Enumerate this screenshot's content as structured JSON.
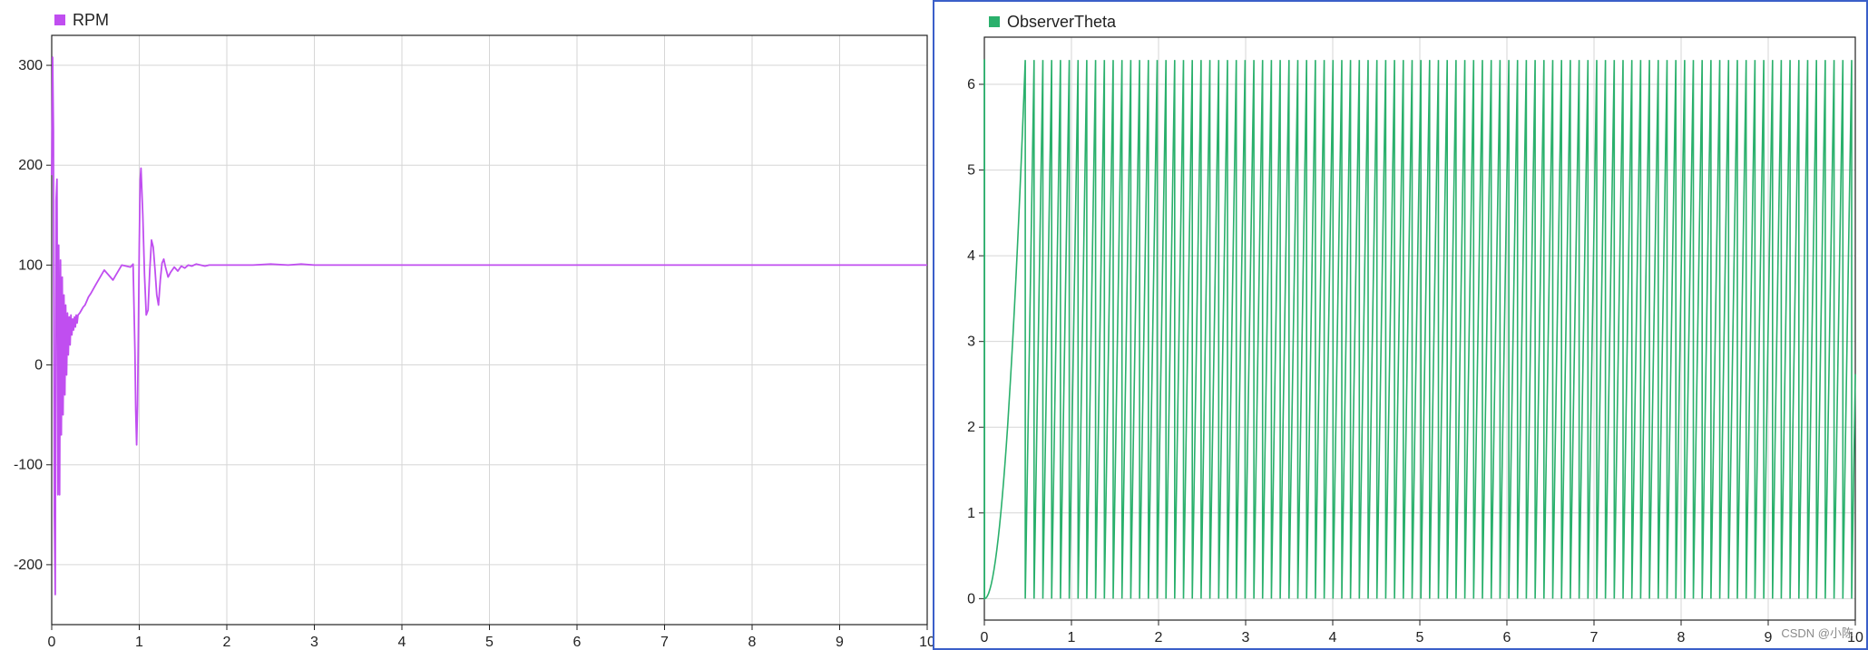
{
  "colors": {
    "rpm": "#c04ef0",
    "theta": "#2ab06c",
    "grid": "#d6d6d6",
    "axis": "#222222",
    "panel_border": "#3b5fc9"
  },
  "watermark": "CSDN @小陈",
  "chart_data": [
    {
      "type": "line",
      "title": "",
      "legend": [
        "RPM"
      ],
      "legend_position": "top-left",
      "grid": true,
      "xlim": [
        0,
        10
      ],
      "ylim": [
        -260,
        330
      ],
      "xticks": [
        0,
        1,
        2,
        3,
        4,
        5,
        6,
        7,
        8,
        9,
        10
      ],
      "yticks": [
        -200,
        -100,
        0,
        100,
        200,
        300
      ],
      "series": [
        {
          "name": "RPM",
          "x": [
            0.0,
            0.01,
            0.02,
            0.03,
            0.04,
            0.05,
            0.06,
            0.07,
            0.08,
            0.09,
            0.1,
            0.11,
            0.12,
            0.13,
            0.14,
            0.15,
            0.16,
            0.17,
            0.18,
            0.19,
            0.2,
            0.21,
            0.22,
            0.23,
            0.24,
            0.25,
            0.26,
            0.27,
            0.28,
            0.29,
            0.3,
            0.32,
            0.34,
            0.36,
            0.38,
            0.4,
            0.42,
            0.45,
            0.5,
            0.6,
            0.7,
            0.8,
            0.9,
            0.93,
            0.95,
            0.96,
            0.97,
            0.98,
            0.99,
            1.0,
            1.01,
            1.02,
            1.04,
            1.06,
            1.08,
            1.1,
            1.12,
            1.14,
            1.16,
            1.18,
            1.2,
            1.22,
            1.24,
            1.26,
            1.28,
            1.3,
            1.33,
            1.36,
            1.4,
            1.44,
            1.48,
            1.52,
            1.56,
            1.6,
            1.65,
            1.7,
            1.75,
            1.8,
            1.85,
            1.9,
            2.0,
            2.1,
            2.3,
            2.5,
            2.7,
            2.85,
            3.0,
            4.0,
            5.0,
            6.0,
            7.0,
            8.0,
            9.0,
            10.0
          ],
          "y": [
            190,
            308,
            235,
            -150,
            -230,
            165,
            186,
            -130,
            120,
            -130,
            105,
            -70,
            88,
            -50,
            70,
            -30,
            60,
            -10,
            52,
            10,
            48,
            20,
            50,
            30,
            46,
            35,
            48,
            38,
            50,
            42,
            50,
            52,
            55,
            58,
            60,
            64,
            68,
            72,
            80,
            95,
            85,
            100,
            98,
            101,
            15,
            -45,
            -80,
            -40,
            30,
            120,
            185,
            197,
            150,
            90,
            50,
            55,
            95,
            125,
            118,
            95,
            70,
            60,
            85,
            102,
            106,
            98,
            88,
            93,
            98,
            94,
            99,
            97,
            100,
            99,
            101,
            100,
            99,
            100,
            100,
            100,
            100,
            100,
            100,
            101,
            100,
            101,
            100,
            100,
            100,
            100,
            100,
            100,
            100,
            100
          ]
        }
      ]
    },
    {
      "type": "line",
      "title": "",
      "legend": [
        "ObserverTheta"
      ],
      "legend_position": "top-left",
      "grid": true,
      "xlim": [
        0,
        10
      ],
      "ylim": [
        -0.25,
        6.55
      ],
      "xticks": [
        0,
        1,
        2,
        3,
        4,
        5,
        6,
        7,
        8,
        9,
        10
      ],
      "yticks": [
        0,
        1,
        2,
        3,
        4,
        5,
        6
      ],
      "series": [
        {
          "name": "ObserverTheta",
          "description": "sawtooth wrapping 0..6.2832; near-vertical first rise at t=0, slow ramp until ~0.47 s, then regular sawtooth with ~95 cycles up to t=10",
          "wrap_max": 6.2832,
          "ramp_end": 0.47,
          "cycle_count": 95,
          "end_value": 2.62
        }
      ]
    }
  ]
}
